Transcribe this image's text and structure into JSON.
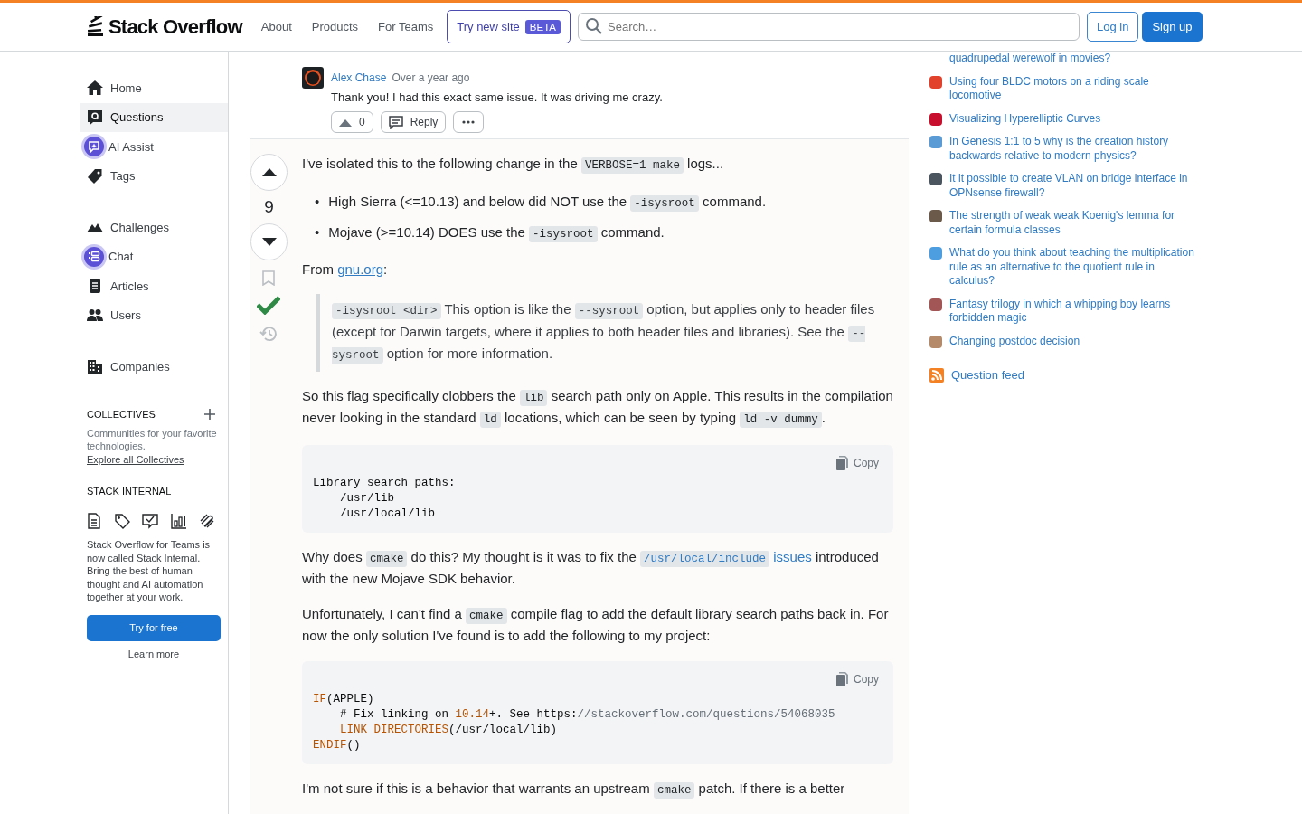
{
  "header": {
    "logo": "Stack Overflow",
    "nav": [
      "About",
      "Products",
      "For Teams"
    ],
    "try_new_site": {
      "label": "Try new site",
      "badge": "BETA"
    },
    "search": {
      "placeholder": "Search…"
    },
    "log_in": "Log in",
    "sign_up": "Sign up"
  },
  "left_nav": {
    "groups": [
      [
        {
          "label": "Home",
          "selected": false,
          "kind": "plain"
        },
        {
          "label": "Questions",
          "selected": true,
          "kind": "plain"
        },
        {
          "label": "AI Assist",
          "selected": false,
          "kind": "badge"
        },
        {
          "label": "Tags",
          "selected": false,
          "kind": "plain"
        }
      ],
      [
        {
          "label": "Challenges",
          "selected": false,
          "kind": "plain"
        },
        {
          "label": "Chat",
          "selected": false,
          "kind": "badge"
        },
        {
          "label": "Articles",
          "selected": false,
          "kind": "plain"
        },
        {
          "label": "Users",
          "selected": false,
          "kind": "plain"
        }
      ],
      [
        {
          "label": "Companies",
          "selected": false,
          "kind": "plain"
        }
      ]
    ],
    "collectives": {
      "title": "COLLECTIVES",
      "text": "Communities for your favorite technologies.",
      "link": "Explore all Collectives"
    },
    "stack_internal": {
      "title": "STACK INTERNAL",
      "text": "Stack Overflow for Teams is now called Stack Internal. Bring the best of human thought and AI automation together at your work.",
      "button": "Try for free",
      "link": "Learn more"
    }
  },
  "comment": {
    "author": "Alex Chase",
    "time": "Over a year ago",
    "text": "Thank you! I had this exact same issue. It was driving me crazy.",
    "votes": "0",
    "reply": "Reply"
  },
  "answer": {
    "votes": "9",
    "accepted": true,
    "bookmarked": false,
    "body": [
      {
        "kind": "paragraph",
        "segments": [
          {
            "kind": "text",
            "text": "I've isolated this to the following change in the "
          },
          {
            "kind": "code",
            "text": "VERBOSE=1 make"
          },
          {
            "kind": "text",
            "text": " logs..."
          }
        ]
      },
      {
        "kind": "list",
        "items": [
          {
            "marker": "•",
            "segments": [
              {
                "kind": "text",
                "text": "High Sierra (<=10.13) and below did NOT use the "
              },
              {
                "kind": "code",
                "text": "-isysroot"
              },
              {
                "kind": "text",
                "text": " command."
              }
            ]
          },
          {
            "marker": "•",
            "segments": [
              {
                "kind": "text",
                "text": "Mojave (>=10.14) DOES use the "
              },
              {
                "kind": "code",
                "text": "-isysroot"
              },
              {
                "kind": "text",
                "text": " command."
              }
            ]
          }
        ]
      },
      {
        "kind": "paragraph",
        "segments": [
          {
            "kind": "text",
            "text": "From "
          },
          {
            "kind": "link",
            "text": "gnu.org"
          },
          {
            "kind": "text",
            "text": ":"
          }
        ]
      },
      {
        "kind": "quote",
        "segments": [
          {
            "kind": "code",
            "text": "-isysroot <dir>"
          },
          {
            "kind": "text",
            "text": " This option is like the "
          },
          {
            "kind": "code",
            "text": "--sysroot"
          },
          {
            "kind": "text",
            "text": " option, but applies only to header files (except for Darwin targets, where it applies to both header files and libraries). See the "
          },
          {
            "kind": "code",
            "text": "--sysroot"
          },
          {
            "kind": "text",
            "text": " option for more information."
          }
        ]
      },
      {
        "kind": "paragraph",
        "segments": [
          {
            "kind": "text",
            "text": "So this flag specifically clobbers the "
          },
          {
            "kind": "code",
            "text": "lib"
          },
          {
            "kind": "text",
            "text": " search path only on Apple. This results in the compilation never looking in the standard "
          },
          {
            "kind": "code",
            "text": "ld"
          },
          {
            "kind": "text",
            "text": " locations, which can be seen by typing "
          },
          {
            "kind": "code",
            "text": "ld -v dummy"
          },
          {
            "kind": "text",
            "text": "."
          }
        ]
      },
      {
        "kind": "codeblock",
        "copy": "Copy",
        "lines": [
          [
            {
              "kind": "plain",
              "text": "Library search paths:"
            }
          ],
          [
            {
              "kind": "plain",
              "text": "    /usr/lib"
            }
          ],
          [
            {
              "kind": "plain",
              "text": "    /usr/local/lib"
            }
          ]
        ]
      },
      {
        "kind": "paragraph",
        "segments": [
          {
            "kind": "text",
            "text": "Why does "
          },
          {
            "kind": "code",
            "text": "cmake"
          },
          {
            "kind": "text",
            "text": " do this? My thought is it was to fix the "
          },
          {
            "kind": "link",
            "code": "/usr/local/include",
            "text": " issues"
          },
          {
            "kind": "text",
            "text": " introduced with the new Mojave SDK behavior."
          }
        ]
      },
      {
        "kind": "paragraph",
        "segments": [
          {
            "kind": "text",
            "text": "Unfortunately, I can't find a "
          },
          {
            "kind": "code",
            "text": "cmake"
          },
          {
            "kind": "text",
            "text": " compile flag to add the default library search paths back in. For now the only solution I've found is to add the following to my project:"
          }
        ]
      },
      {
        "kind": "codeblock",
        "copy": "Copy",
        "lines": [
          [
            {
              "kind": "keyword",
              "text": "IF"
            },
            {
              "kind": "plain",
              "text": "(APPLE)"
            }
          ],
          [
            {
              "kind": "plain",
              "text": "    # Fix linking on "
            },
            {
              "kind": "keyword",
              "text": "10.14"
            },
            {
              "kind": "plain",
              "text": "+. See https:"
            },
            {
              "kind": "comment",
              "text": "//stackoverflow.com/questions/54068035"
            }
          ],
          [
            {
              "kind": "keyword",
              "text": "    LINK_DIRECTORIES"
            },
            {
              "kind": "plain",
              "text": "(/usr/local/lib)"
            }
          ],
          [
            {
              "kind": "keyword",
              "text": "ENDIF"
            },
            {
              "kind": "plain",
              "text": "()"
            }
          ]
        ]
      },
      {
        "kind": "paragraph",
        "segments": [
          {
            "kind": "text",
            "text": "I'm not sure if this is a behavior that warrants an upstream "
          },
          {
            "kind": "code",
            "text": "cmake"
          },
          {
            "kind": "text",
            "text": " patch. If there is a better"
          }
        ]
      }
    ]
  },
  "hot_questions": {
    "cut_text": "quadrupedal werewolf in movies?",
    "items": [
      {
        "title": "Using four BLDC motors on a riding scale locomotive",
        "color": "#e2422b"
      },
      {
        "title": "Visualizing Hyperelliptic Curves",
        "color": "#c8102e"
      },
      {
        "title": "In Genesis 1:1 to 5 why is the creation history backwards relative to modern physics?",
        "color": "#5b9bd5"
      },
      {
        "title": "It it possible to create VLAN on bridge interface in OPNsense firewall?",
        "color": "#4a5560"
      },
      {
        "title": "The strength of weak weak Koenig's lemma for certain formula classes",
        "color": "#6b5a4a"
      },
      {
        "title": "What do you think about teaching the multiplication rule as an alternative to the quotient rule in calculus?",
        "color": "#4d9ee0"
      },
      {
        "title": "Fantasy trilogy in which a whipping boy learns forbidden magic",
        "color": "#a25656"
      },
      {
        "title": "Changing postdoc decision",
        "color": "#b48a6a"
      }
    ],
    "feed": "Question feed"
  }
}
